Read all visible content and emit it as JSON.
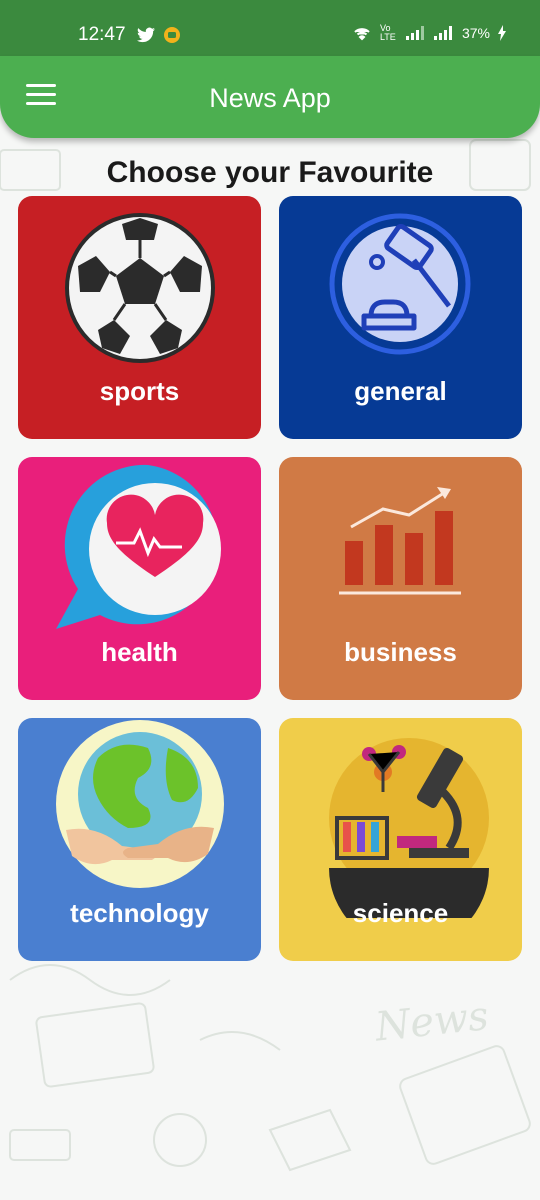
{
  "status_bar": {
    "time": "12:47",
    "battery": "37%",
    "network_label": "Vo LTE"
  },
  "app_bar": {
    "title": "News App"
  },
  "page": {
    "heading": "Choose your Favourite"
  },
  "categories": [
    {
      "label": "sports",
      "color": "#c61f24",
      "icon": "soccer-ball-icon"
    },
    {
      "label": "general",
      "color": "#063a95",
      "icon": "gavel-icon"
    },
    {
      "label": "health",
      "color": "#e91f7b",
      "icon": "heart-chat-icon"
    },
    {
      "label": "business",
      "color": "#d07a45",
      "icon": "bar-chart-icon"
    },
    {
      "label": "technology",
      "color": "#4a7fd0",
      "icon": "globe-hands-icon"
    },
    {
      "label": "science",
      "color": "#f0cd4a",
      "icon": "microscope-lab-icon"
    }
  ],
  "colors": {
    "status_bar": "#3b8a3e",
    "app_bar": "#4caf50"
  }
}
